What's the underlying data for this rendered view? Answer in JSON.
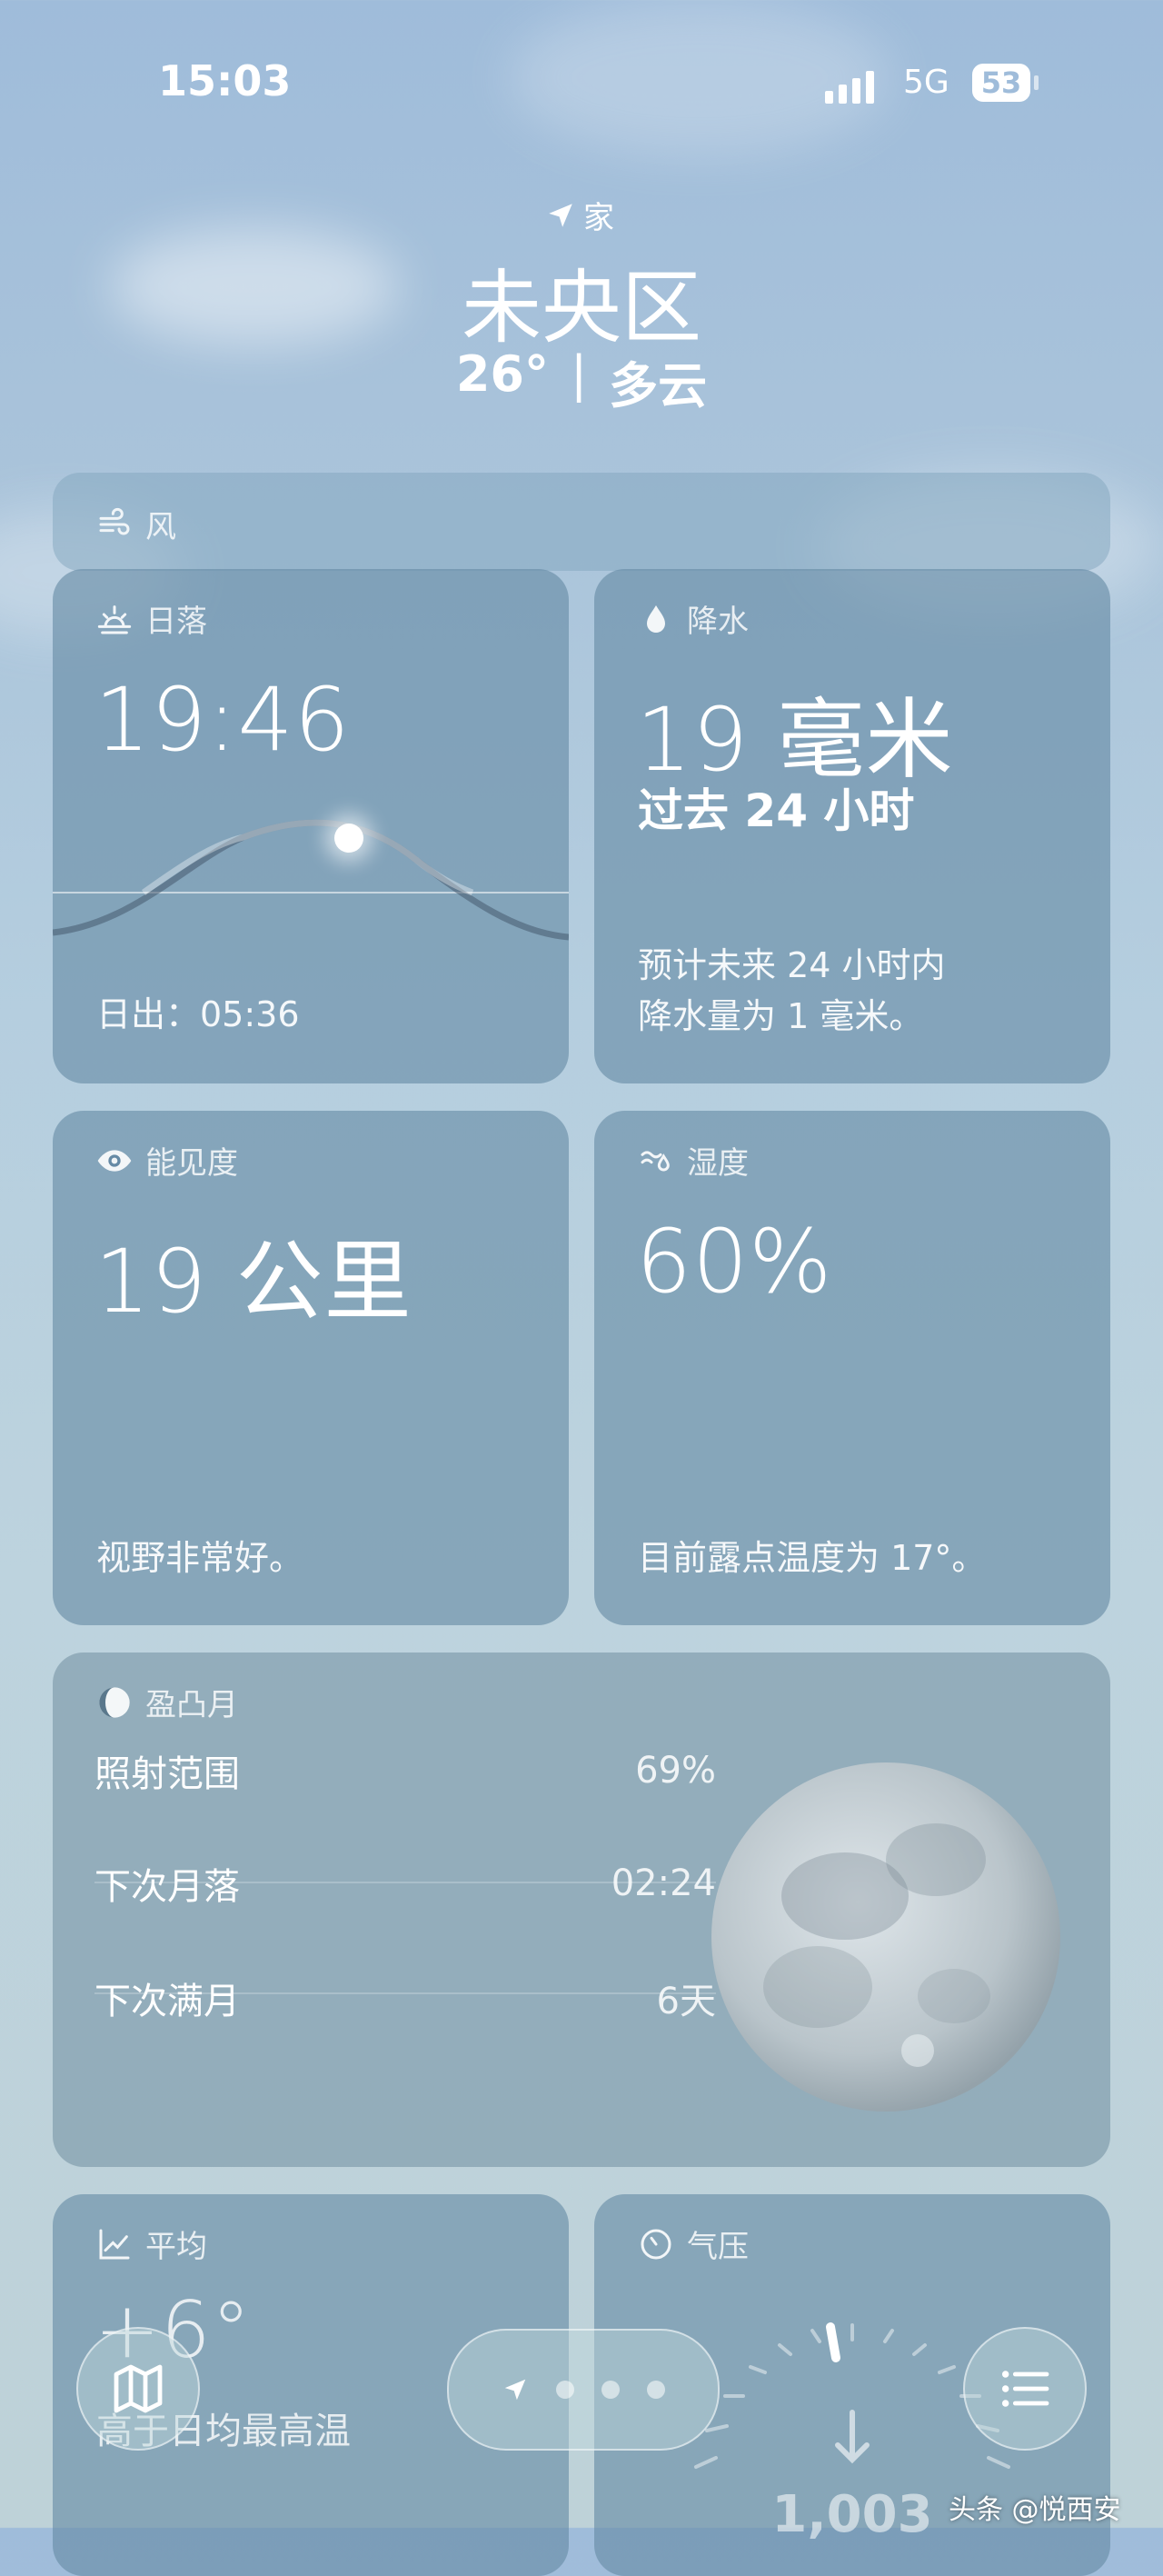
{
  "status": {
    "time": "15:03",
    "network": "5G",
    "battery": "53"
  },
  "location": {
    "tag": "家",
    "city": "未央区",
    "temp": "26°",
    "divider": "|",
    "condition": "多云"
  },
  "wind": {
    "label": "风"
  },
  "sunset": {
    "label": "日落",
    "time": "19:46",
    "sunrise": "日出：05:36"
  },
  "precip": {
    "label": "降水",
    "amount": "19 毫米",
    "period": "过去 24 小时",
    "forecast_line1": "预计未来 24 小时内",
    "forecast_line2": "降水量为 1 毫米。"
  },
  "visibility": {
    "label": "能见度",
    "value": "19 公里",
    "desc": "视野非常好。"
  },
  "humidity": {
    "label": "湿度",
    "value": "60%",
    "desc": "目前露点温度为 17°。"
  },
  "moon": {
    "label": "盈凸月",
    "rows": [
      {
        "label": "照射范围",
        "value": "69%"
      },
      {
        "label": "下次月落",
        "value": "02:24"
      },
      {
        "label": "下次满月",
        "value": "6天"
      }
    ]
  },
  "average": {
    "label": "平均",
    "value": "+6°",
    "desc": "高于日均最高温"
  },
  "pressure": {
    "label": "气压",
    "value": "1,003"
  },
  "watermark": "头条 @悦西安",
  "icons": [
    "location-arrow-icon",
    "wind-icon",
    "sunset-icon",
    "raindrop-icon",
    "eye-icon",
    "humidity-icon",
    "moon-phase-icon",
    "trend-icon",
    "gauge-icon",
    "map-icon",
    "list-icon"
  ]
}
